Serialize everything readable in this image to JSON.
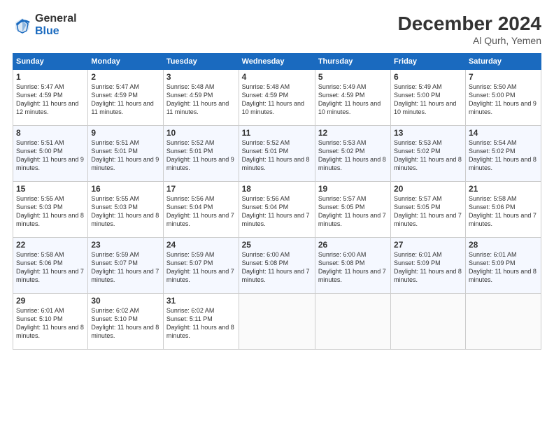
{
  "header": {
    "logo_general": "General",
    "logo_blue": "Blue",
    "month_title": "December 2024",
    "location": "Al Qurh, Yemen"
  },
  "days_of_week": [
    "Sunday",
    "Monday",
    "Tuesday",
    "Wednesday",
    "Thursday",
    "Friday",
    "Saturday"
  ],
  "weeks": [
    [
      {
        "day": "1",
        "sunrise": "5:47 AM",
        "sunset": "4:59 PM",
        "daylight": "11 hours and 12 minutes."
      },
      {
        "day": "2",
        "sunrise": "5:47 AM",
        "sunset": "4:59 PM",
        "daylight": "11 hours and 11 minutes."
      },
      {
        "day": "3",
        "sunrise": "5:48 AM",
        "sunset": "4:59 PM",
        "daylight": "11 hours and 11 minutes."
      },
      {
        "day": "4",
        "sunrise": "5:48 AM",
        "sunset": "4:59 PM",
        "daylight": "11 hours and 10 minutes."
      },
      {
        "day": "5",
        "sunrise": "5:49 AM",
        "sunset": "4:59 PM",
        "daylight": "11 hours and 10 minutes."
      },
      {
        "day": "6",
        "sunrise": "5:49 AM",
        "sunset": "5:00 PM",
        "daylight": "11 hours and 10 minutes."
      },
      {
        "day": "7",
        "sunrise": "5:50 AM",
        "sunset": "5:00 PM",
        "daylight": "11 hours and 9 minutes."
      }
    ],
    [
      {
        "day": "8",
        "sunrise": "5:51 AM",
        "sunset": "5:00 PM",
        "daylight": "11 hours and 9 minutes."
      },
      {
        "day": "9",
        "sunrise": "5:51 AM",
        "sunset": "5:01 PM",
        "daylight": "11 hours and 9 minutes."
      },
      {
        "day": "10",
        "sunrise": "5:52 AM",
        "sunset": "5:01 PM",
        "daylight": "11 hours and 9 minutes."
      },
      {
        "day": "11",
        "sunrise": "5:52 AM",
        "sunset": "5:01 PM",
        "daylight": "11 hours and 8 minutes."
      },
      {
        "day": "12",
        "sunrise": "5:53 AM",
        "sunset": "5:02 PM",
        "daylight": "11 hours and 8 minutes."
      },
      {
        "day": "13",
        "sunrise": "5:53 AM",
        "sunset": "5:02 PM",
        "daylight": "11 hours and 8 minutes."
      },
      {
        "day": "14",
        "sunrise": "5:54 AM",
        "sunset": "5:02 PM",
        "daylight": "11 hours and 8 minutes."
      }
    ],
    [
      {
        "day": "15",
        "sunrise": "5:55 AM",
        "sunset": "5:03 PM",
        "daylight": "11 hours and 8 minutes."
      },
      {
        "day": "16",
        "sunrise": "5:55 AM",
        "sunset": "5:03 PM",
        "daylight": "11 hours and 8 minutes."
      },
      {
        "day": "17",
        "sunrise": "5:56 AM",
        "sunset": "5:04 PM",
        "daylight": "11 hours and 7 minutes."
      },
      {
        "day": "18",
        "sunrise": "5:56 AM",
        "sunset": "5:04 PM",
        "daylight": "11 hours and 7 minutes."
      },
      {
        "day": "19",
        "sunrise": "5:57 AM",
        "sunset": "5:05 PM",
        "daylight": "11 hours and 7 minutes."
      },
      {
        "day": "20",
        "sunrise": "5:57 AM",
        "sunset": "5:05 PM",
        "daylight": "11 hours and 7 minutes."
      },
      {
        "day": "21",
        "sunrise": "5:58 AM",
        "sunset": "5:06 PM",
        "daylight": "11 hours and 7 minutes."
      }
    ],
    [
      {
        "day": "22",
        "sunrise": "5:58 AM",
        "sunset": "5:06 PM",
        "daylight": "11 hours and 7 minutes."
      },
      {
        "day": "23",
        "sunrise": "5:59 AM",
        "sunset": "5:07 PM",
        "daylight": "11 hours and 7 minutes."
      },
      {
        "day": "24",
        "sunrise": "5:59 AM",
        "sunset": "5:07 PM",
        "daylight": "11 hours and 7 minutes."
      },
      {
        "day": "25",
        "sunrise": "6:00 AM",
        "sunset": "5:08 PM",
        "daylight": "11 hours and 7 minutes."
      },
      {
        "day": "26",
        "sunrise": "6:00 AM",
        "sunset": "5:08 PM",
        "daylight": "11 hours and 7 minutes."
      },
      {
        "day": "27",
        "sunrise": "6:01 AM",
        "sunset": "5:09 PM",
        "daylight": "11 hours and 8 minutes."
      },
      {
        "day": "28",
        "sunrise": "6:01 AM",
        "sunset": "5:09 PM",
        "daylight": "11 hours and 8 minutes."
      }
    ],
    [
      {
        "day": "29",
        "sunrise": "6:01 AM",
        "sunset": "5:10 PM",
        "daylight": "11 hours and 8 minutes."
      },
      {
        "day": "30",
        "sunrise": "6:02 AM",
        "sunset": "5:10 PM",
        "daylight": "11 hours and 8 minutes."
      },
      {
        "day": "31",
        "sunrise": "6:02 AM",
        "sunset": "5:11 PM",
        "daylight": "11 hours and 8 minutes."
      },
      null,
      null,
      null,
      null
    ]
  ]
}
